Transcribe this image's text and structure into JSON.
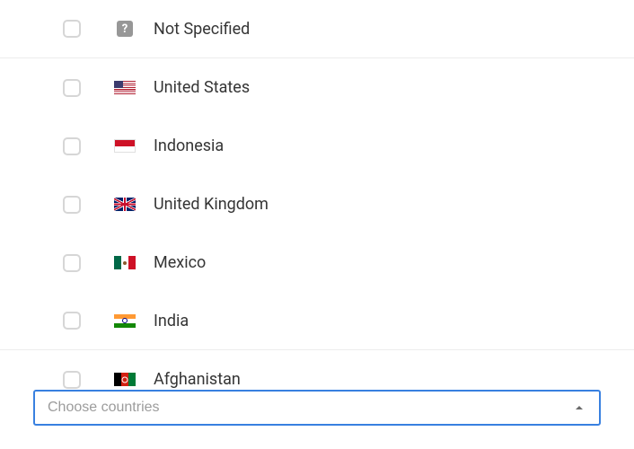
{
  "combobox": {
    "placeholder": "Choose countries",
    "value": "",
    "expanded": true
  },
  "countries": {
    "items": [
      {
        "id": "not-specified",
        "label": "Not Specified",
        "checked": false,
        "flag": "none",
        "divider_after": true
      },
      {
        "id": "us",
        "label": "United States",
        "checked": false,
        "flag": "united-states",
        "divider_after": false
      },
      {
        "id": "id",
        "label": "Indonesia",
        "checked": false,
        "flag": "indonesia",
        "divider_after": false
      },
      {
        "id": "gb",
        "label": "United Kingdom",
        "checked": false,
        "flag": "united-kingdom",
        "divider_after": false
      },
      {
        "id": "mx",
        "label": "Mexico",
        "checked": false,
        "flag": "mexico",
        "divider_after": false
      },
      {
        "id": "in",
        "label": "India",
        "checked": false,
        "flag": "india",
        "divider_after": true
      },
      {
        "id": "af",
        "label": "Afghanistan",
        "checked": false,
        "flag": "afghanistan",
        "divider_after": false
      }
    ]
  },
  "colors": {
    "focus_border": "#3880e0",
    "checkbox_border": "#d6d6d6",
    "text": "#353535",
    "placeholder": "#9c9c9c",
    "divider": "#ececec"
  }
}
